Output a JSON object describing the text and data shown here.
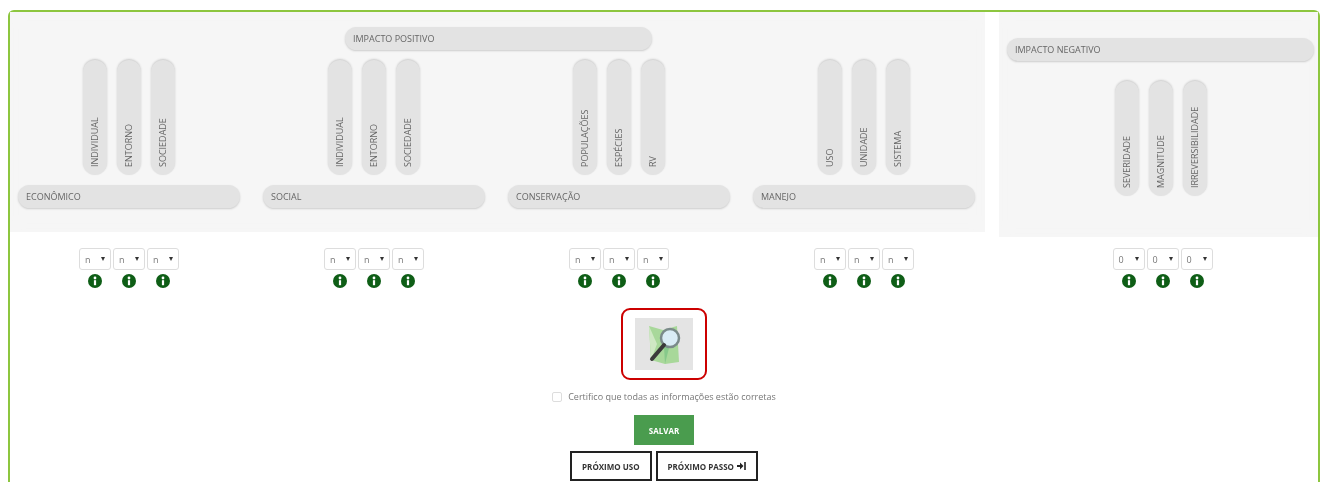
{
  "positive_impact": {
    "title": "IMPACTO POSITIVO",
    "groups": [
      {
        "title": "ECONÔMICO",
        "criteria": [
          {
            "label": "INDIVIDUAL",
            "value": "n"
          },
          {
            "label": "ENTORNO",
            "value": "n"
          },
          {
            "label": "SOCIEDADE",
            "value": "n"
          }
        ]
      },
      {
        "title": "SOCIAL",
        "criteria": [
          {
            "label": "INDIVIDUAL",
            "value": "n"
          },
          {
            "label": "ENTORNO",
            "value": "n"
          },
          {
            "label": "SOCIEDADE",
            "value": "n"
          }
        ]
      },
      {
        "title": "CONSERVAÇÃO",
        "criteria": [
          {
            "label": "POPULAÇÕES",
            "value": "n"
          },
          {
            "label": "ESPÉCIES",
            "value": "n"
          },
          {
            "label": "RV",
            "value": "n"
          }
        ]
      },
      {
        "title": "MANEJO",
        "criteria": [
          {
            "label": "USO",
            "value": "n"
          },
          {
            "label": "UNIDADE",
            "value": "n"
          },
          {
            "label": "SISTEMA",
            "value": "n"
          }
        ]
      }
    ]
  },
  "negative_impact": {
    "title": "IMPACTO NEGATIVO",
    "criteria": [
      {
        "label": "SEVERIDADE",
        "value": "0"
      },
      {
        "label": "MAGNITUDE",
        "value": "0"
      },
      {
        "label": "IRREVERSIBILIDADE",
        "value": "0"
      }
    ]
  },
  "certify": {
    "label": "Certifico que todas as informações estão corretas",
    "checked": false
  },
  "buttons": [
    {
      "label": "SALVAR",
      "kind": "save"
    },
    {
      "label": "PRÓXIMO USO",
      "kind": "outline"
    },
    {
      "label": "PRÓXIMO PASSO",
      "kind": "outline-icon"
    }
  ]
}
